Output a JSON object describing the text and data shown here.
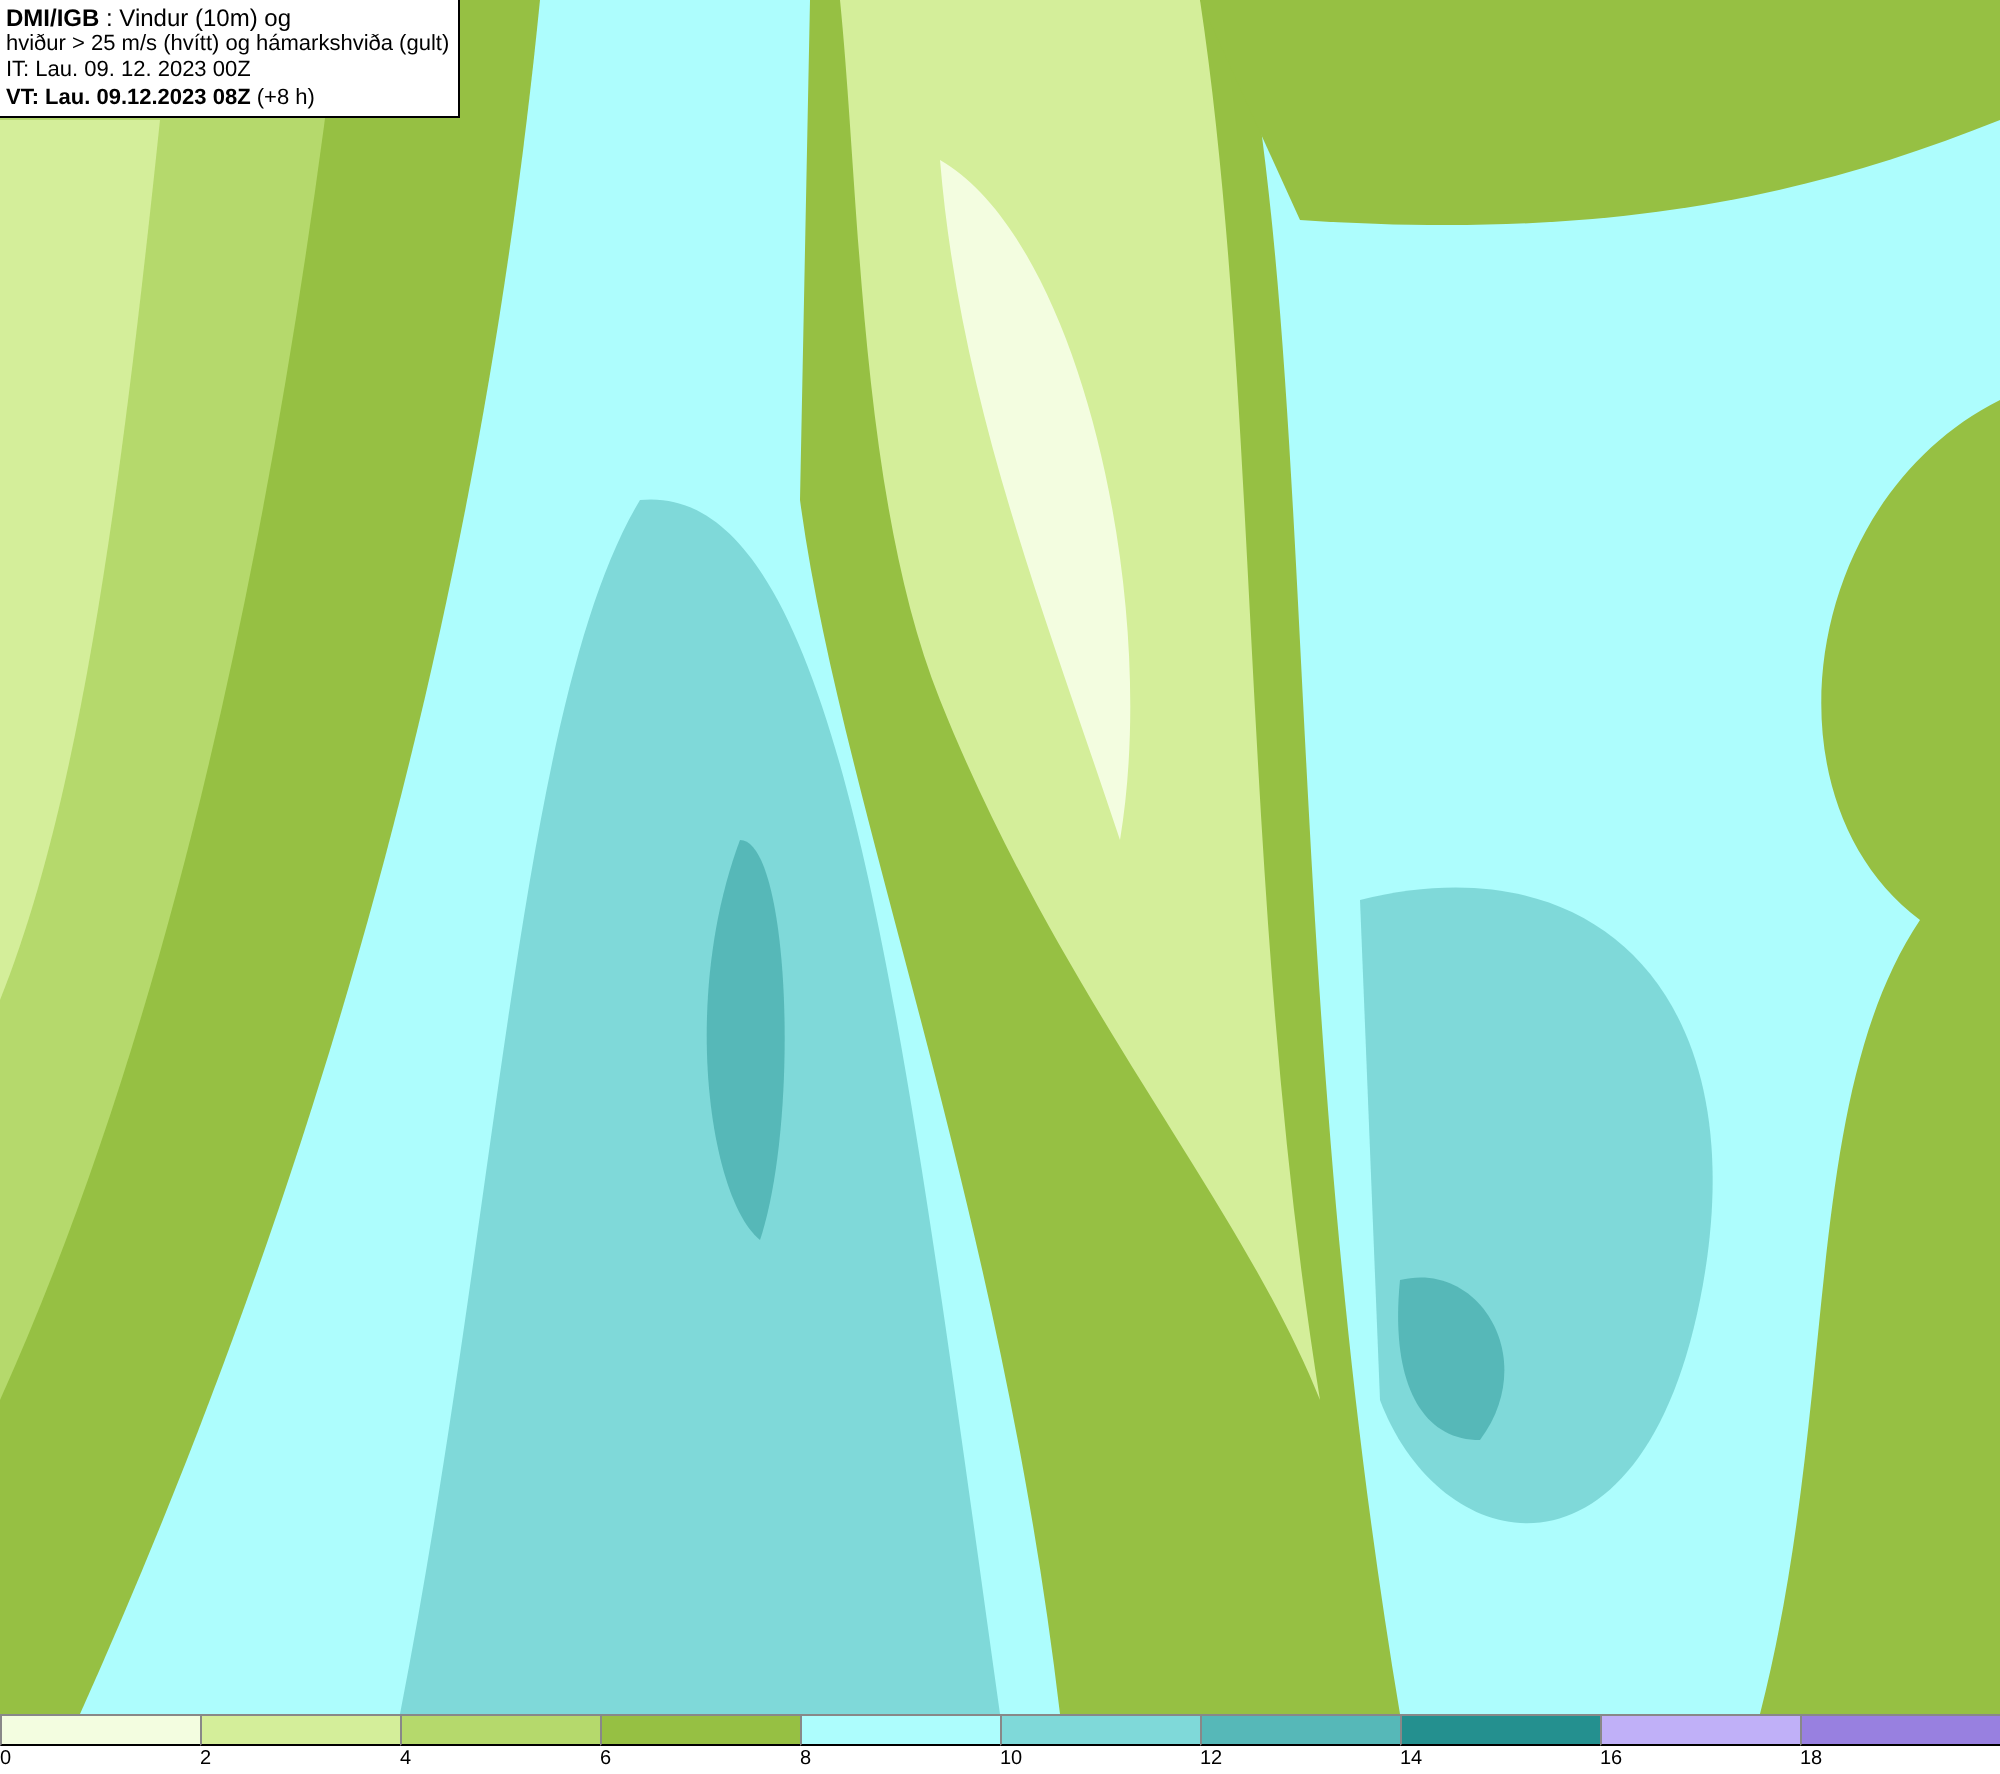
{
  "info": {
    "lines": [
      {
        "kind": "title",
        "text": "**DMI/IGB** : Vindur (10m) og"
      },
      {
        "kind": "subtitle",
        "text": "hviður > 25 m/s (hvítt) og hámarkshviða (gult)"
      },
      {
        "kind": "issue",
        "text": "IT: Lau. 09. 12. 2023 00Z"
      },
      {
        "kind": "valid",
        "text": "**VT: Lau. 09.12.2023 08Z** (+8 h)"
      }
    ]
  },
  "legend": {
    "bins": [
      {
        "color": "#f3fde0",
        "tick": "0"
      },
      {
        "color": "#d4ee9a",
        "tick": "2"
      },
      {
        "color": "#b5d96c",
        "tick": "4"
      },
      {
        "color": "#96c043",
        "tick": "6"
      },
      {
        "color": "#adfdfd",
        "tick": "8"
      },
      {
        "color": "#7fd9d9",
        "tick": "10"
      },
      {
        "color": "#56b8b8",
        "tick": "12"
      },
      {
        "color": "#24908f",
        "tick": "14"
      },
      {
        "color": "#c0b0f8",
        "tick": "16"
      },
      {
        "color": "#9880e0",
        "tick": "18"
      }
    ]
  }
}
